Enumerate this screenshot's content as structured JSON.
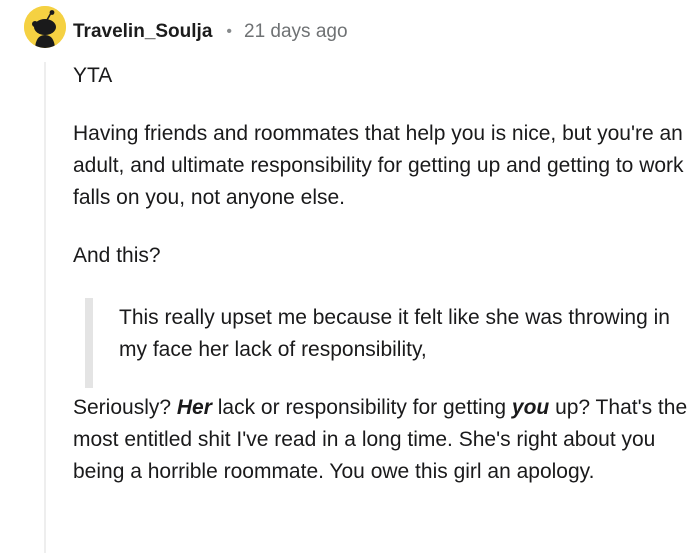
{
  "comment": {
    "username": "Travelin_Soulja",
    "separator": "•",
    "timestamp": "21 days ago",
    "avatar_icon": "reddit-snoo-avatar-icon",
    "avatar_color": "#f5d142",
    "paragraphs": {
      "verdict": "YTA",
      "main": "Having friends and roommates that help you is nice, but you're an adult, and ultimate responsibility for getting up and getting to work falls on you, not anyone else.",
      "and_this": "And this?"
    },
    "quote": "This really upset me because it felt like she was throwing in my face her lack of responsibility,",
    "final": {
      "part1": "Seriously? ",
      "her": "Her",
      "part2": " lack or responsibility for getting ",
      "you": "you",
      "part3": " up? That's the most entitled shit I've read in a long time. She's right about you being a horrible roommate. You owe this girl an apology."
    }
  }
}
